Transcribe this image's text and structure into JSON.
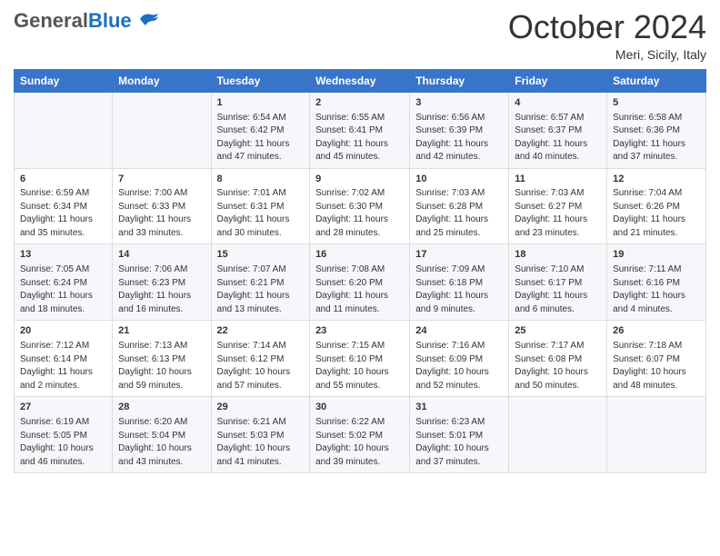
{
  "header": {
    "logo_general": "General",
    "logo_blue": "Blue",
    "month_title": "October 2024",
    "location": "Meri, Sicily, Italy"
  },
  "columns": [
    "Sunday",
    "Monday",
    "Tuesday",
    "Wednesday",
    "Thursday",
    "Friday",
    "Saturday"
  ],
  "weeks": [
    {
      "cells": [
        {
          "day": "",
          "content": ""
        },
        {
          "day": "",
          "content": ""
        },
        {
          "day": "1",
          "content": "Sunrise: 6:54 AM\nSunset: 6:42 PM\nDaylight: 11 hours and 47 minutes."
        },
        {
          "day": "2",
          "content": "Sunrise: 6:55 AM\nSunset: 6:41 PM\nDaylight: 11 hours and 45 minutes."
        },
        {
          "day": "3",
          "content": "Sunrise: 6:56 AM\nSunset: 6:39 PM\nDaylight: 11 hours and 42 minutes."
        },
        {
          "day": "4",
          "content": "Sunrise: 6:57 AM\nSunset: 6:37 PM\nDaylight: 11 hours and 40 minutes."
        },
        {
          "day": "5",
          "content": "Sunrise: 6:58 AM\nSunset: 6:36 PM\nDaylight: 11 hours and 37 minutes."
        }
      ]
    },
    {
      "cells": [
        {
          "day": "6",
          "content": "Sunrise: 6:59 AM\nSunset: 6:34 PM\nDaylight: 11 hours and 35 minutes."
        },
        {
          "day": "7",
          "content": "Sunrise: 7:00 AM\nSunset: 6:33 PM\nDaylight: 11 hours and 33 minutes."
        },
        {
          "day": "8",
          "content": "Sunrise: 7:01 AM\nSunset: 6:31 PM\nDaylight: 11 hours and 30 minutes."
        },
        {
          "day": "9",
          "content": "Sunrise: 7:02 AM\nSunset: 6:30 PM\nDaylight: 11 hours and 28 minutes."
        },
        {
          "day": "10",
          "content": "Sunrise: 7:03 AM\nSunset: 6:28 PM\nDaylight: 11 hours and 25 minutes."
        },
        {
          "day": "11",
          "content": "Sunrise: 7:03 AM\nSunset: 6:27 PM\nDaylight: 11 hours and 23 minutes."
        },
        {
          "day": "12",
          "content": "Sunrise: 7:04 AM\nSunset: 6:26 PM\nDaylight: 11 hours and 21 minutes."
        }
      ]
    },
    {
      "cells": [
        {
          "day": "13",
          "content": "Sunrise: 7:05 AM\nSunset: 6:24 PM\nDaylight: 11 hours and 18 minutes."
        },
        {
          "day": "14",
          "content": "Sunrise: 7:06 AM\nSunset: 6:23 PM\nDaylight: 11 hours and 16 minutes."
        },
        {
          "day": "15",
          "content": "Sunrise: 7:07 AM\nSunset: 6:21 PM\nDaylight: 11 hours and 13 minutes."
        },
        {
          "day": "16",
          "content": "Sunrise: 7:08 AM\nSunset: 6:20 PM\nDaylight: 11 hours and 11 minutes."
        },
        {
          "day": "17",
          "content": "Sunrise: 7:09 AM\nSunset: 6:18 PM\nDaylight: 11 hours and 9 minutes."
        },
        {
          "day": "18",
          "content": "Sunrise: 7:10 AM\nSunset: 6:17 PM\nDaylight: 11 hours and 6 minutes."
        },
        {
          "day": "19",
          "content": "Sunrise: 7:11 AM\nSunset: 6:16 PM\nDaylight: 11 hours and 4 minutes."
        }
      ]
    },
    {
      "cells": [
        {
          "day": "20",
          "content": "Sunrise: 7:12 AM\nSunset: 6:14 PM\nDaylight: 11 hours and 2 minutes."
        },
        {
          "day": "21",
          "content": "Sunrise: 7:13 AM\nSunset: 6:13 PM\nDaylight: 10 hours and 59 minutes."
        },
        {
          "day": "22",
          "content": "Sunrise: 7:14 AM\nSunset: 6:12 PM\nDaylight: 10 hours and 57 minutes."
        },
        {
          "day": "23",
          "content": "Sunrise: 7:15 AM\nSunset: 6:10 PM\nDaylight: 10 hours and 55 minutes."
        },
        {
          "day": "24",
          "content": "Sunrise: 7:16 AM\nSunset: 6:09 PM\nDaylight: 10 hours and 52 minutes."
        },
        {
          "day": "25",
          "content": "Sunrise: 7:17 AM\nSunset: 6:08 PM\nDaylight: 10 hours and 50 minutes."
        },
        {
          "day": "26",
          "content": "Sunrise: 7:18 AM\nSunset: 6:07 PM\nDaylight: 10 hours and 48 minutes."
        }
      ]
    },
    {
      "cells": [
        {
          "day": "27",
          "content": "Sunrise: 6:19 AM\nSunset: 5:05 PM\nDaylight: 10 hours and 46 minutes."
        },
        {
          "day": "28",
          "content": "Sunrise: 6:20 AM\nSunset: 5:04 PM\nDaylight: 10 hours and 43 minutes."
        },
        {
          "day": "29",
          "content": "Sunrise: 6:21 AM\nSunset: 5:03 PM\nDaylight: 10 hours and 41 minutes."
        },
        {
          "day": "30",
          "content": "Sunrise: 6:22 AM\nSunset: 5:02 PM\nDaylight: 10 hours and 39 minutes."
        },
        {
          "day": "31",
          "content": "Sunrise: 6:23 AM\nSunset: 5:01 PM\nDaylight: 10 hours and 37 minutes."
        },
        {
          "day": "",
          "content": ""
        },
        {
          "day": "",
          "content": ""
        }
      ]
    }
  ]
}
